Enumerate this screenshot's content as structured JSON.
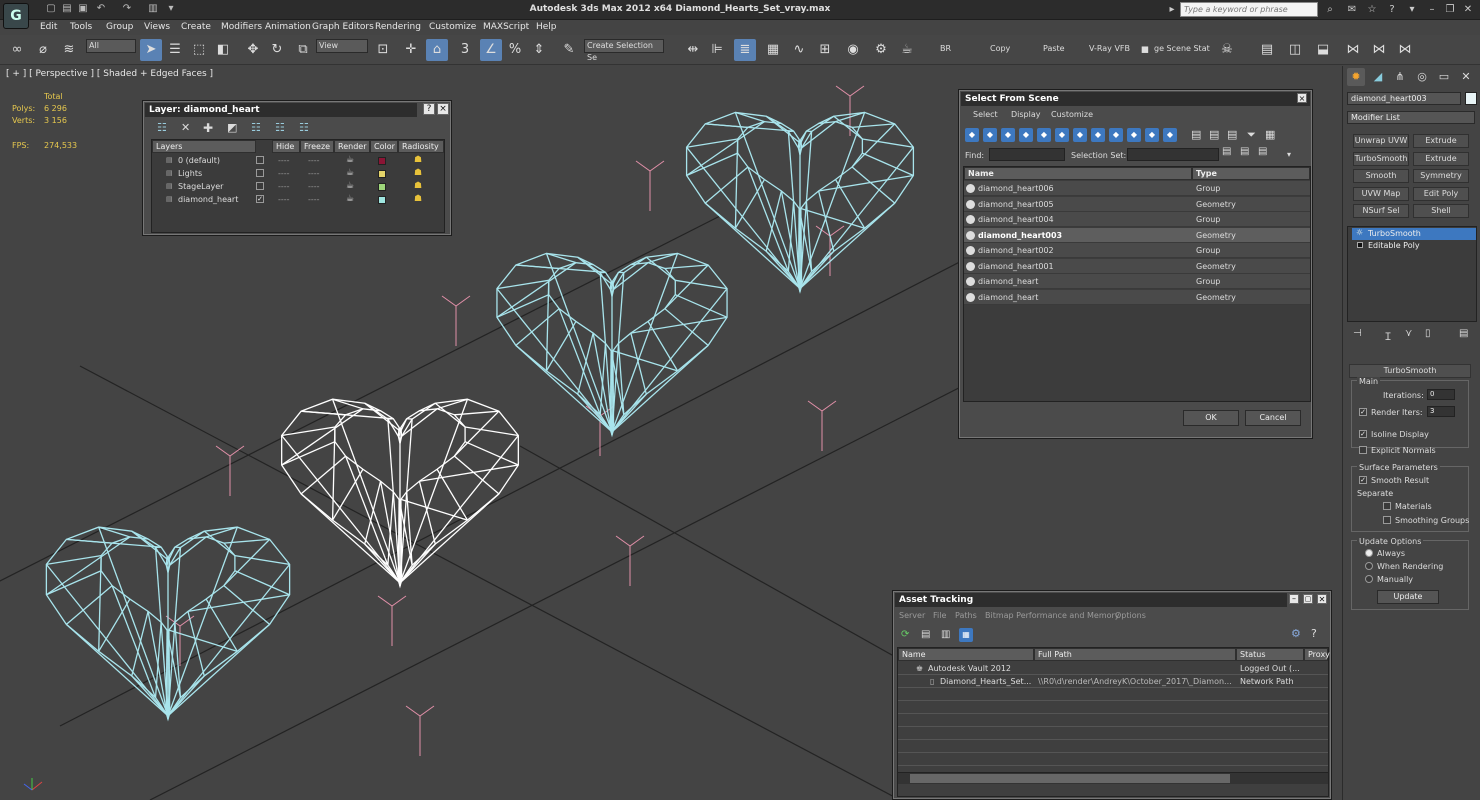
{
  "window": {
    "title": "Autodesk 3ds Max  2012 x64     Diamond_Hearts_Set_vray.max",
    "keyword_placeholder": "Type a keyword or phrase",
    "logo_letter": "G"
  },
  "menu": [
    "Edit",
    "Tools",
    "Group",
    "Views",
    "Create",
    "Modifiers",
    "Animation",
    "Graph Editors",
    "Rendering",
    "Customize",
    "MAXScript",
    "Help"
  ],
  "toolbar": {
    "filter_value": "All",
    "coord_value": "View",
    "snap_value": "3",
    "selection_set_placeholder": "Create Selection Se",
    "br_label": "BR",
    "copy_label": "Copy",
    "paste_label": "Paste",
    "vray_label": "V-Ray VFB",
    "stage_label": "ge Scene Stat"
  },
  "viewport": {
    "label": "[ + ] [ Perspective ] [ Shaded + Edged Faces ]",
    "stats": {
      "total_label": "Total",
      "polys_label": "Polys:",
      "polys_value": "6 296",
      "verts_label": "Verts:",
      "verts_value": "3 156",
      "fps_label": "FPS:",
      "fps_value": "274,533"
    }
  },
  "layer_dialog": {
    "title": "Layer: diamond_heart",
    "help": "?",
    "close": "×",
    "columns": [
      "Layers",
      "Hide",
      "Freeze",
      "Render",
      "Color",
      "Radiosity"
    ],
    "rows": [
      {
        "name": "0 (default)",
        "checked": "",
        "color": "#8b1535"
      },
      {
        "name": "Lights",
        "checked": "",
        "color": "#e4d46a"
      },
      {
        "name": "StageLayer",
        "checked": "",
        "color": "#9ed67a"
      },
      {
        "name": "diamond_heart",
        "checked": "✓",
        "color": "#9fe6e0"
      }
    ],
    "hide_mark": "----",
    "freeze_mark": "----"
  },
  "select_dialog": {
    "title": "Select From Scene",
    "close": "×",
    "menu": [
      "Select",
      "Display",
      "Customize"
    ],
    "find_label": "Find:",
    "selection_set_label": "Selection Set:",
    "columns": [
      "Name",
      "Type"
    ],
    "rows": [
      {
        "name": "diamond_heart006",
        "type": "Group",
        "selected": false
      },
      {
        "name": "diamond_heart005",
        "type": "Geometry",
        "selected": false
      },
      {
        "name": "diamond_heart004",
        "type": "Group",
        "selected": false
      },
      {
        "name": "diamond_heart003",
        "type": "Geometry",
        "selected": true
      },
      {
        "name": "diamond_heart002",
        "type": "Group",
        "selected": false
      },
      {
        "name": "diamond_heart001",
        "type": "Geometry",
        "selected": false
      },
      {
        "name": "diamond_heart",
        "type": "Group",
        "selected": false
      },
      {
        "name": "diamond_heart",
        "type": "Geometry",
        "selected": false
      }
    ],
    "ok": "OK",
    "cancel": "Cancel"
  },
  "asset_dialog": {
    "title": "Asset Tracking",
    "menu": [
      "Server",
      "File",
      "Paths",
      "Bitmap Performance and Memory",
      "Options"
    ],
    "columns": [
      "Name",
      "Full Path",
      "Status",
      "Proxy"
    ],
    "rows": [
      {
        "name": "Autodesk Vault 2012",
        "path": "",
        "status": "Logged Out (..."
      },
      {
        "name": "Diamond_Hearts_Set...",
        "path": "\\\\R0\\d\\render\\AndreyK\\October_2017\\_Diamon...",
        "status": "Network Path"
      }
    ]
  },
  "command_panel": {
    "object_name": "diamond_heart003",
    "modifier_list": "Modifier List",
    "buttons": [
      "Unwrap UVW",
      "Extrude",
      "TurboSmooth",
      "Extrude",
      "Smooth",
      "Symmetry",
      "UVW Map",
      "Edit Poly",
      "NSurf Sel",
      "Shell"
    ],
    "stack": [
      "TurboSmooth",
      "Editable Poly"
    ],
    "rollout_title": "TurboSmooth",
    "main_label": "Main",
    "iterations_label": "Iterations:",
    "iterations_value": "0",
    "render_iters_label": "Render Iters:",
    "render_iters_value": "3",
    "isoline_label": "Isoline Display",
    "explicit_label": "Explicit Normals",
    "surface_label": "Surface Parameters",
    "smooth_result_label": "Smooth Result",
    "separate_label": "Separate",
    "materials_label": "Materials",
    "smoothing_groups_label": "Smoothing Groups",
    "update_options_label": "Update Options",
    "always_label": "Always",
    "when_rendering_label": "When Rendering",
    "manually_label": "Manually",
    "update_button": "Update"
  },
  "colors": {
    "wire_blue": "#a8e4ec",
    "wire_white": "#ffffff",
    "helper_pink": "#e08fa8",
    "selection_blue": "#3d78c0"
  }
}
